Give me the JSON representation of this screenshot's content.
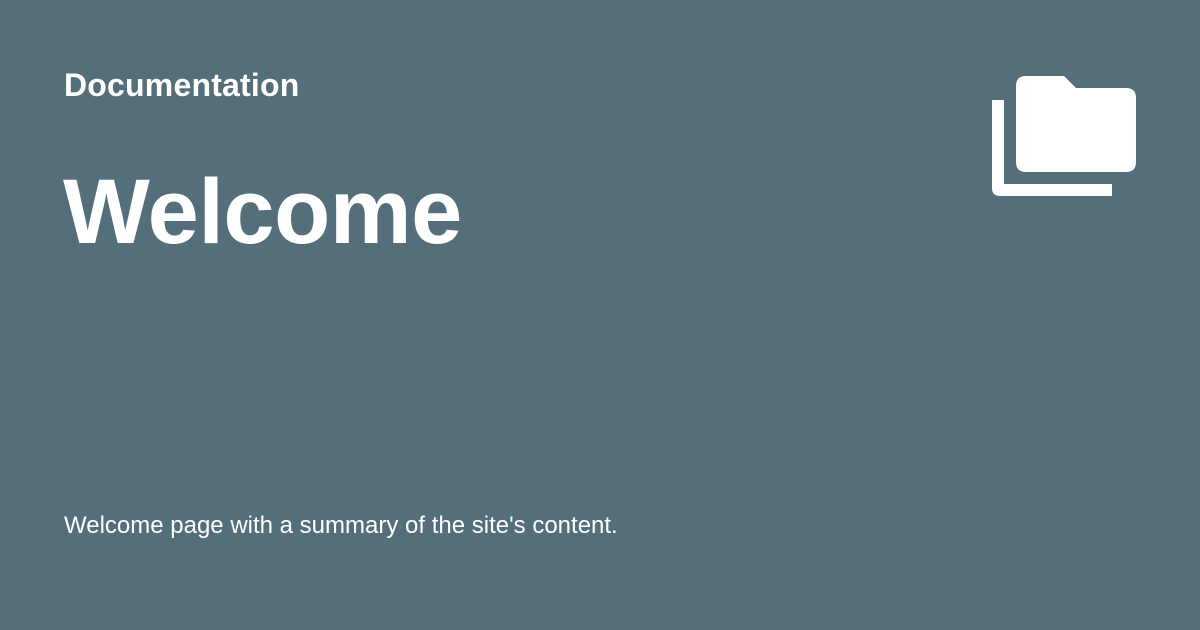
{
  "header": {
    "site_name": "Documentation"
  },
  "main": {
    "title": "Welcome",
    "description": "Welcome page with a summary of the site's content."
  },
  "icon": {
    "name": "folder-multiple-icon",
    "color": "#ffffff"
  },
  "colors": {
    "background": "#546e7a",
    "text": "#ffffff"
  }
}
